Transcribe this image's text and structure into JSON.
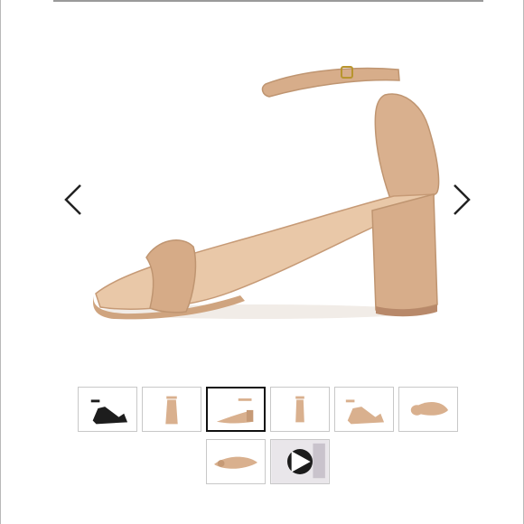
{
  "colors": {
    "background": "#ffffff",
    "frame_border": "#b8b8b8",
    "top_rule": "#9a9a9a",
    "thumb_border": "#c8c8c8",
    "selected_thumb_border": "#111111",
    "shoe_nude": "#d9b08e",
    "shoe_nude_dark": "#c69a76",
    "shoe_black": "#1d1d1d"
  },
  "gallery": {
    "main_image_icon": "nude-ankle-strap-block-heel-sandal",
    "prev_icon": "chevron-left-icon",
    "next_icon": "chevron-right-icon",
    "selected_index": 2,
    "thumbnails": [
      {
        "icon": "black-sandal-angle-view"
      },
      {
        "icon": "nude-sandal-front-view"
      },
      {
        "icon": "nude-sandal-side-view"
      },
      {
        "icon": "nude-sandal-back-view"
      },
      {
        "icon": "nude-sandal-angle-view"
      },
      {
        "icon": "nude-sandal-top-view"
      },
      {
        "icon": "nude-sandal-sole-view"
      },
      {
        "icon": "video-play-icon"
      }
    ]
  }
}
